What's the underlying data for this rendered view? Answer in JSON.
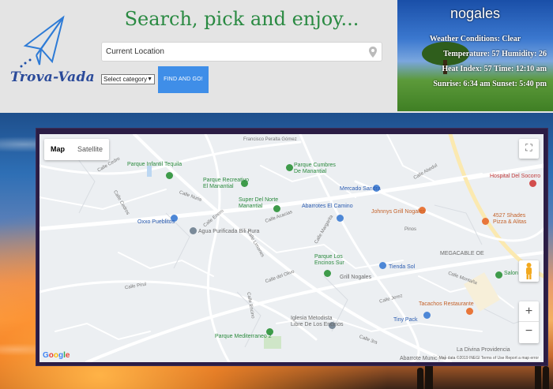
{
  "header": {
    "logo_text": "Trova-Vada",
    "headline": "Search, pick and enjoy...",
    "search": {
      "value": "Current Location",
      "placeholder": "Current Location"
    },
    "category": {
      "selected": "Select category"
    },
    "find_button": "FIND AND GO!"
  },
  "weather": {
    "city": "nogales",
    "conditions": "Weather Conditions: Clear",
    "temp_humidity": "Temperature: 57 Humidity: 26",
    "heat_time": "Heat Index: 57 Time: 12:10 am",
    "sun": "Sunrise: 6:34 am Sunset: 5:40 pm"
  },
  "map": {
    "type_map": "Map",
    "type_satellite": "Satellite",
    "google": "Google",
    "attribution": "Map data ©2019 INEGI   Terms of Use   Report a map error",
    "pois": {
      "p1": "Parque Infantil Tequila",
      "p2": "Parque Recreativo\nEl Manantial",
      "p3": "Parque Cumbres\nDe Manantial",
      "p4": "Super Del Norte\nManantial",
      "p5": "Mercado Sandra",
      "p6": "Hospital Del Socorro",
      "p7": "Abarrotes El Camino",
      "p8": "Johnnys Grill Nogales",
      "p9": "Oxxo Pueblitos",
      "p10": "Agua Purificada Bili Pura",
      "p11": "Parque Los\nEncinos Sur",
      "p12": "Grill Nogales",
      "p13": "Tienda Sol",
      "p14": "MEGACABLE OE",
      "p15": "Salon Club",
      "p16": "Tacachos Restaurante",
      "p17": "Iglesia Metodista\nLibre De Los Encinos",
      "p18": "Parque Mediterraneo 2",
      "p19": "Tiny Pack",
      "p20": "Abarrote Municipal",
      "p21": "La Divina Providencia",
      "p22": "4527 Shades\nPizza & Alitas"
    },
    "streets": {
      "s1": "Francisco Peralta Gómez",
      "s2": "Calle Cedro",
      "s3": "Calle Nuria",
      "s4": "Calle Enero",
      "s5": "Calle Acacias",
      "s6": "Calle Abedul",
      "s7": "Pinos",
      "s8": "Calle Margarita",
      "s9": "Calle Limones",
      "s10": "Calle del Olivo",
      "s11": "Calle Jerez",
      "s12": "Calle Encino",
      "s13": "Calle 3ra",
      "s14": "Calle Cedros",
      "s15": "Calle Montaña",
      "s16": "Calle Pirul"
    }
  }
}
